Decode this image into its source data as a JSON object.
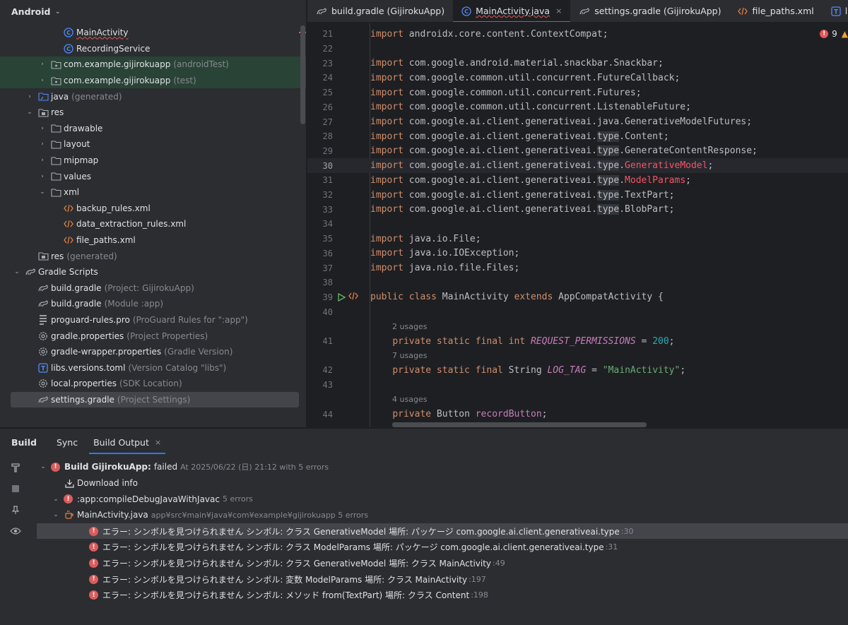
{
  "project": {
    "title": "Android",
    "tree": [
      {
        "label": "MainActivity",
        "secondary": "",
        "icon": "class-icon",
        "depth": 4,
        "arrow": "",
        "wavy": true,
        "marker": true
      },
      {
        "label": "RecordingService",
        "secondary": "",
        "icon": "class-icon",
        "depth": 4,
        "arrow": "",
        "wavy": false,
        "marker": false
      },
      {
        "label": "com.example.gijirokuapp",
        "secondary": "(androidTest)",
        "icon": "package-icon",
        "depth": 3,
        "arrow": "›",
        "wavy": false,
        "marker": false,
        "green": true
      },
      {
        "label": "com.example.gijirokuapp",
        "secondary": "(test)",
        "icon": "package-icon",
        "depth": 3,
        "arrow": "›",
        "wavy": false,
        "marker": false,
        "green": true
      },
      {
        "label": "java",
        "secondary": "(generated)",
        "icon": "generated-folder-icon",
        "depth": 2,
        "arrow": "›"
      },
      {
        "label": "res",
        "secondary": "",
        "icon": "res-folder-icon",
        "depth": 2,
        "arrow": "⌄"
      },
      {
        "label": "drawable",
        "secondary": "",
        "icon": "folder-icon",
        "depth": 3,
        "arrow": "›"
      },
      {
        "label": "layout",
        "secondary": "",
        "icon": "folder-icon",
        "depth": 3,
        "arrow": "›"
      },
      {
        "label": "mipmap",
        "secondary": "",
        "icon": "folder-icon",
        "depth": 3,
        "arrow": "›"
      },
      {
        "label": "values",
        "secondary": "",
        "icon": "folder-icon",
        "depth": 3,
        "arrow": "›"
      },
      {
        "label": "xml",
        "secondary": "",
        "icon": "folder-icon",
        "depth": 3,
        "arrow": "⌄"
      },
      {
        "label": "backup_rules.xml",
        "secondary": "",
        "icon": "xml-file-icon",
        "depth": 4,
        "arrow": ""
      },
      {
        "label": "data_extraction_rules.xml",
        "secondary": "",
        "icon": "xml-file-icon",
        "depth": 4,
        "arrow": ""
      },
      {
        "label": "file_paths.xml",
        "secondary": "",
        "icon": "xml-file-icon",
        "depth": 4,
        "arrow": ""
      },
      {
        "label": "res",
        "secondary": "(generated)",
        "icon": "res-folder-icon",
        "depth": 2,
        "arrow": ""
      },
      {
        "label": "Gradle Scripts",
        "secondary": "",
        "icon": "gradle-icon",
        "depth": 0,
        "arrow": "⌄"
      },
      {
        "label": "build.gradle",
        "secondary": "(Project: GijirokuApp)",
        "icon": "gradle-icon",
        "depth": 2,
        "arrow": ""
      },
      {
        "label": "build.gradle",
        "secondary": "(Module :app)",
        "icon": "gradle-icon",
        "depth": 2,
        "arrow": ""
      },
      {
        "label": "proguard-rules.pro",
        "secondary": "(ProGuard Rules for \":app\")",
        "icon": "text-file-icon",
        "depth": 2,
        "arrow": ""
      },
      {
        "label": "gradle.properties",
        "secondary": "(Project Properties)",
        "icon": "settings-file-icon",
        "depth": 2,
        "arrow": ""
      },
      {
        "label": "gradle-wrapper.properties",
        "secondary": "(Gradle Version)",
        "icon": "settings-file-icon",
        "depth": 2,
        "arrow": ""
      },
      {
        "label": "libs.versions.toml",
        "secondary": "(Version Catalog \"libs\")",
        "icon": "toml-file-icon",
        "depth": 2,
        "arrow": ""
      },
      {
        "label": "local.properties",
        "secondary": "(SDK Location)",
        "icon": "settings-file-icon",
        "depth": 2,
        "arrow": ""
      },
      {
        "label": "settings.gradle",
        "secondary": "(Project Settings)",
        "icon": "gradle-icon",
        "depth": 2,
        "arrow": "",
        "selected": true
      }
    ]
  },
  "tabs": [
    {
      "label": "build.gradle (GijirokuApp)",
      "icon": "gradle-icon",
      "active": false
    },
    {
      "label": "MainActivity.java",
      "icon": "class-icon",
      "active": true
    },
    {
      "label": "settings.gradle (GijirokuApp)",
      "icon": "gradle-icon",
      "active": false
    },
    {
      "label": "file_paths.xml",
      "icon": "xml-file-icon",
      "active": false
    },
    {
      "label": "libs.versions.toml",
      "icon": "toml-file-icon",
      "active": false
    }
  ],
  "editor": {
    "error_count": "9",
    "close_tab_glyph": "×",
    "lines": [
      {
        "num": "21",
        "html": "<span class='kw'>import</span> androidx.core.content.ContextCompat;"
      },
      {
        "num": "22",
        "html": ""
      },
      {
        "num": "23",
        "html": "<span class='kw'>import</span> com.google.android.material.snackbar.Snackbar;"
      },
      {
        "num": "24",
        "html": "<span class='kw'>import</span> com.google.common.util.concurrent.FutureCallback;"
      },
      {
        "num": "25",
        "html": "<span class='kw'>import</span> com.google.common.util.concurrent.Futures;"
      },
      {
        "num": "26",
        "html": "<span class='kw'>import</span> com.google.common.util.concurrent.ListenableFuture;"
      },
      {
        "num": "27",
        "html": "<span class='kw'>import</span> com.google.ai.client.generativeai.java.GenerativeModelFutures;"
      },
      {
        "num": "28",
        "html": "<span class='kw'>import</span> com.google.ai.client.generativeai.<span class='typebox'>type</span>.Content;"
      },
      {
        "num": "29",
        "html": "<span class='kw'>import</span> com.google.ai.client.generativeai.<span class='typebox'>type</span>.GenerateContentResponse;"
      },
      {
        "num": "30",
        "html": "<span class='kw'>import</span> com.google.ai.client.generativeai.<span class='typebox'>type</span>.<span class='err'>GenerativeModel</span>;",
        "current": true
      },
      {
        "num": "31",
        "html": "<span class='kw'>import</span> com.google.ai.client.generativeai.<span class='typebox'>type</span>.<span class='err'>ModelParams</span>;"
      },
      {
        "num": "32",
        "html": "<span class='kw'>import</span> com.google.ai.client.generativeai.<span class='typebox'>type</span>.TextPart;"
      },
      {
        "num": "33",
        "html": "<span class='kw'>import</span> com.google.ai.client.generativeai.<span class='typebox'>type</span>.BlobPart;"
      },
      {
        "num": "34",
        "html": ""
      },
      {
        "num": "35",
        "html": "<span class='kw'>import</span> java.io.File;"
      },
      {
        "num": "36",
        "html": "<span class='kw'>import</span> java.io.IOException;"
      },
      {
        "num": "37",
        "html": "<span class='kw'>import</span> java.nio.file.Files;"
      },
      {
        "num": "38",
        "html": ""
      },
      {
        "num": "39",
        "html": "<span class='kw'>public class</span> MainActivity <span class='kw'>extends</span> AppCompatActivity {",
        "run": true
      },
      {
        "num": "40",
        "html": ""
      },
      {
        "num": "",
        "usages": "2 usages"
      },
      {
        "num": "41",
        "html": "    <span class='kw'>private static final int</span> <span class='const'>REQUEST_PERMISSIONS</span> = <span class='num'>200</span>;"
      },
      {
        "num": "",
        "usages": "7 usages"
      },
      {
        "num": "42",
        "html": "    <span class='kw'>private static final</span> String <span class='const'>LOG_TAG</span> = <span class='str'>\"MainActivity\"</span>;"
      },
      {
        "num": "43",
        "html": ""
      },
      {
        "num": "",
        "usages": "4 usages"
      },
      {
        "num": "44",
        "html": "    <span class='kw'>private</span> Button <span class='fld'>recordButton</span>;"
      }
    ]
  },
  "build": {
    "title": "Build",
    "tabs": [
      {
        "label": "Sync",
        "active": false
      },
      {
        "label": "Build Output",
        "active": true
      }
    ],
    "tree": [
      {
        "arrow": "⌄",
        "indent": 0,
        "error": true,
        "label": "Build GijirokuApp:",
        "label2": "failed",
        "secondary": "At 2025/06/22 (日) 21:12 with 5 errors",
        "bold": true
      },
      {
        "arrow": "",
        "indent": 1,
        "icon": "download-icon",
        "label": "Download info",
        "secondary": ""
      },
      {
        "arrow": "⌄",
        "indent": 1,
        "error": true,
        "label": ":app:compileDebugJavaWithJavac",
        "secondary": "5 errors"
      },
      {
        "arrow": "⌄",
        "indent": 2,
        "icon": "java-file-icon",
        "label": "MainActivity.java",
        "secondary": "app¥src¥main¥java¥com¥example¥gijirokuapp 5 errors"
      },
      {
        "arrow": "",
        "indent": 3,
        "error": true,
        "label": "エラー: シンボルを見つけられません シンボル:   クラス GenerativeModel 場所: パッケージ com.google.ai.client.generativeai.type",
        "line": ":30",
        "selected": true
      },
      {
        "arrow": "",
        "indent": 3,
        "error": true,
        "label": "エラー: シンボルを見つけられません シンボル:   クラス ModelParams 場所: パッケージ com.google.ai.client.generativeai.type",
        "line": ":31"
      },
      {
        "arrow": "",
        "indent": 3,
        "error": true,
        "label": "エラー: シンボルを見つけられません シンボル:   クラス GenerativeModel 場所: クラス MainActivity",
        "line": ":49"
      },
      {
        "arrow": "",
        "indent": 3,
        "error": true,
        "label": "エラー: シンボルを見つけられません シンボル:   変数 ModelParams 場所: クラス MainActivity",
        "line": ":197"
      },
      {
        "arrow": "",
        "indent": 3,
        "error": true,
        "label": "エラー: シンボルを見つけられません シンボル:   メソッド from(TextPart) 場所: クラス Content",
        "line": ":198"
      }
    ]
  }
}
